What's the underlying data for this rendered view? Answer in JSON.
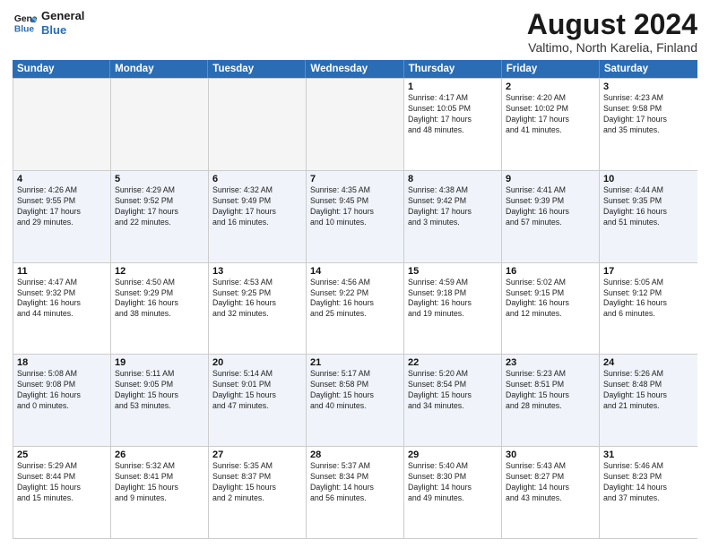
{
  "logo": {
    "line1": "General",
    "line2": "Blue"
  },
  "title": "August 2024",
  "subtitle": "Valtimo, North Karelia, Finland",
  "header_days": [
    "Sunday",
    "Monday",
    "Tuesday",
    "Wednesday",
    "Thursday",
    "Friday",
    "Saturday"
  ],
  "rows": [
    [
      {
        "day": "",
        "text": "",
        "empty": true
      },
      {
        "day": "",
        "text": "",
        "empty": true
      },
      {
        "day": "",
        "text": "",
        "empty": true
      },
      {
        "day": "",
        "text": "",
        "empty": true
      },
      {
        "day": "1",
        "text": "Sunrise: 4:17 AM\nSunset: 10:05 PM\nDaylight: 17 hours\nand 48 minutes."
      },
      {
        "day": "2",
        "text": "Sunrise: 4:20 AM\nSunset: 10:02 PM\nDaylight: 17 hours\nand 41 minutes."
      },
      {
        "day": "3",
        "text": "Sunrise: 4:23 AM\nSunset: 9:58 PM\nDaylight: 17 hours\nand 35 minutes."
      }
    ],
    [
      {
        "day": "4",
        "text": "Sunrise: 4:26 AM\nSunset: 9:55 PM\nDaylight: 17 hours\nand 29 minutes."
      },
      {
        "day": "5",
        "text": "Sunrise: 4:29 AM\nSunset: 9:52 PM\nDaylight: 17 hours\nand 22 minutes."
      },
      {
        "day": "6",
        "text": "Sunrise: 4:32 AM\nSunset: 9:49 PM\nDaylight: 17 hours\nand 16 minutes."
      },
      {
        "day": "7",
        "text": "Sunrise: 4:35 AM\nSunset: 9:45 PM\nDaylight: 17 hours\nand 10 minutes."
      },
      {
        "day": "8",
        "text": "Sunrise: 4:38 AM\nSunset: 9:42 PM\nDaylight: 17 hours\nand 3 minutes."
      },
      {
        "day": "9",
        "text": "Sunrise: 4:41 AM\nSunset: 9:39 PM\nDaylight: 16 hours\nand 57 minutes."
      },
      {
        "day": "10",
        "text": "Sunrise: 4:44 AM\nSunset: 9:35 PM\nDaylight: 16 hours\nand 51 minutes."
      }
    ],
    [
      {
        "day": "11",
        "text": "Sunrise: 4:47 AM\nSunset: 9:32 PM\nDaylight: 16 hours\nand 44 minutes."
      },
      {
        "day": "12",
        "text": "Sunrise: 4:50 AM\nSunset: 9:29 PM\nDaylight: 16 hours\nand 38 minutes."
      },
      {
        "day": "13",
        "text": "Sunrise: 4:53 AM\nSunset: 9:25 PM\nDaylight: 16 hours\nand 32 minutes."
      },
      {
        "day": "14",
        "text": "Sunrise: 4:56 AM\nSunset: 9:22 PM\nDaylight: 16 hours\nand 25 minutes."
      },
      {
        "day": "15",
        "text": "Sunrise: 4:59 AM\nSunset: 9:18 PM\nDaylight: 16 hours\nand 19 minutes."
      },
      {
        "day": "16",
        "text": "Sunrise: 5:02 AM\nSunset: 9:15 PM\nDaylight: 16 hours\nand 12 minutes."
      },
      {
        "day": "17",
        "text": "Sunrise: 5:05 AM\nSunset: 9:12 PM\nDaylight: 16 hours\nand 6 minutes."
      }
    ],
    [
      {
        "day": "18",
        "text": "Sunrise: 5:08 AM\nSunset: 9:08 PM\nDaylight: 16 hours\nand 0 minutes."
      },
      {
        "day": "19",
        "text": "Sunrise: 5:11 AM\nSunset: 9:05 PM\nDaylight: 15 hours\nand 53 minutes."
      },
      {
        "day": "20",
        "text": "Sunrise: 5:14 AM\nSunset: 9:01 PM\nDaylight: 15 hours\nand 47 minutes."
      },
      {
        "day": "21",
        "text": "Sunrise: 5:17 AM\nSunset: 8:58 PM\nDaylight: 15 hours\nand 40 minutes."
      },
      {
        "day": "22",
        "text": "Sunrise: 5:20 AM\nSunset: 8:54 PM\nDaylight: 15 hours\nand 34 minutes."
      },
      {
        "day": "23",
        "text": "Sunrise: 5:23 AM\nSunset: 8:51 PM\nDaylight: 15 hours\nand 28 minutes."
      },
      {
        "day": "24",
        "text": "Sunrise: 5:26 AM\nSunset: 8:48 PM\nDaylight: 15 hours\nand 21 minutes."
      }
    ],
    [
      {
        "day": "25",
        "text": "Sunrise: 5:29 AM\nSunset: 8:44 PM\nDaylight: 15 hours\nand 15 minutes."
      },
      {
        "day": "26",
        "text": "Sunrise: 5:32 AM\nSunset: 8:41 PM\nDaylight: 15 hours\nand 9 minutes."
      },
      {
        "day": "27",
        "text": "Sunrise: 5:35 AM\nSunset: 8:37 PM\nDaylight: 15 hours\nand 2 minutes."
      },
      {
        "day": "28",
        "text": "Sunrise: 5:37 AM\nSunset: 8:34 PM\nDaylight: 14 hours\nand 56 minutes."
      },
      {
        "day": "29",
        "text": "Sunrise: 5:40 AM\nSunset: 8:30 PM\nDaylight: 14 hours\nand 49 minutes."
      },
      {
        "day": "30",
        "text": "Sunrise: 5:43 AM\nSunset: 8:27 PM\nDaylight: 14 hours\nand 43 minutes."
      },
      {
        "day": "31",
        "text": "Sunrise: 5:46 AM\nSunset: 8:23 PM\nDaylight: 14 hours\nand 37 minutes."
      }
    ]
  ]
}
